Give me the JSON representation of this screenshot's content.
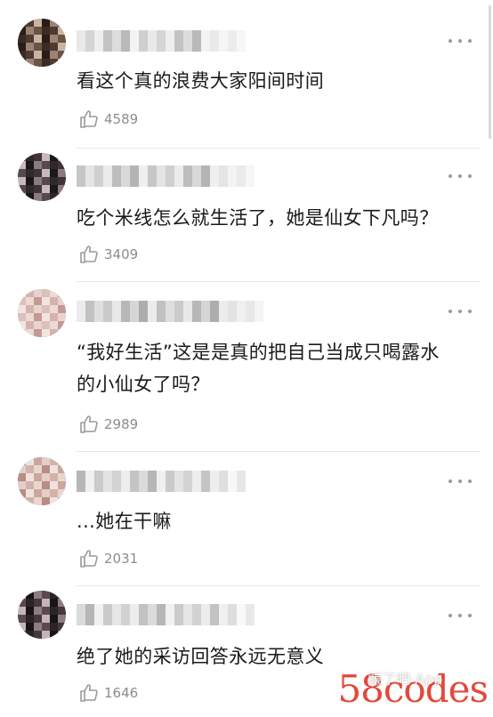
{
  "comments": [
    {
      "text": "看这个真的浪费大家阳间时间",
      "likes": "4589",
      "avatar_colors": [
        "#3b2b24",
        "#6a5446",
        "#9b8474",
        "#2a1c16",
        "#c9b3a2",
        "#4e3b30"
      ],
      "name_colors": [
        "#e9e9e9",
        "#cfcfcf",
        "#f3f3f3",
        "#b9b9b9",
        "#dcdcdc",
        "#c3c3c3",
        "#eeeeee",
        "#d5d5d5"
      ]
    },
    {
      "text": "吃个米线怎么就生活了，她是仙女下凡吗？",
      "likes": "3409",
      "avatar_colors": [
        "#2e2a2c",
        "#56484d",
        "#8b7a80",
        "#1c1719",
        "#c8b9bd",
        "#403438"
      ],
      "name_colors": [
        "#e4e4e4",
        "#c6c6c6",
        "#efefef",
        "#b4b4b4",
        "#d9d9d9",
        "#bdbdbd",
        "#ebebeb",
        "#d0d0d0"
      ]
    },
    {
      "text": "“我好生活”这是是真的把自己当成只喝露水的小仙女了吗？",
      "likes": "2989",
      "avatar_colors": [
        "#e9d3cf",
        "#d4b3ae",
        "#f3e4e1",
        "#c59a94",
        "#efd9d6",
        "#dcc0bb"
      ],
      "name_colors": [
        "#dedede",
        "#c1c1c1",
        "#ececec",
        "#adadad",
        "#d6d6d6",
        "#b8b8b8",
        "#e8e8e8",
        "#cbcbcb"
      ]
    },
    {
      "text": "...她在干嘛",
      "likes": "2031",
      "avatar_colors": [
        "#e2cfc8",
        "#caa79d",
        "#f0e3de",
        "#b88d82",
        "#ead6cf",
        "#d2b3a9"
      ],
      "name_colors": [
        "#e3e3e3",
        "#cacaca",
        "#f0f0f0",
        "#b7b7b7",
        "#dadada",
        "#c4c4c4",
        "#ededed",
        "#d3d3d3"
      ]
    },
    {
      "text": "绝了她的采访回答永远无意义",
      "likes": "1646",
      "avatar_colors": [
        "#2b2426",
        "#5a4a4f",
        "#8e7c82",
        "#1a1416",
        "#c5b5ba",
        "#45383c"
      ],
      "name_colors": [
        "#e6e6e6",
        "#cbcbcb",
        "#f1f1f1",
        "#b6b6b6",
        "#dbdbdb",
        "#c2c2c2",
        "#ececec",
        "#d2d2d2"
      ]
    }
  ],
  "icons": {
    "more": "more-dots-icon",
    "like": "thumbs-up-icon"
  },
  "watermark": {
    "small": "赚了吧 App",
    "big": "58codes"
  },
  "colors": {
    "text": "#1a1a1a",
    "meta": "#8c8c8c",
    "divider": "#e6e6e6",
    "watermark": "#e24a3b"
  }
}
